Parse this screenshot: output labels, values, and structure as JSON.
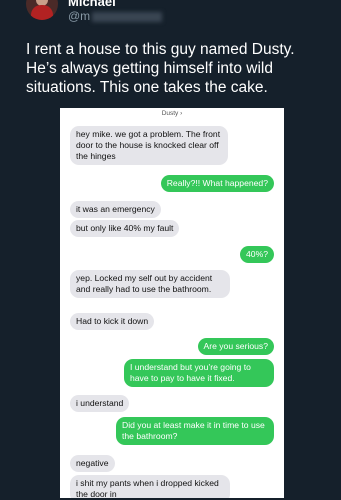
{
  "tweet": {
    "author_name": "Michael",
    "handle_prefix": "@m",
    "text": "I rent a house to this guy named Dusty. He’s always getting himself into wild situations. This one takes the cake."
  },
  "conversation": {
    "contact_name": "Dusty",
    "messages": [
      {
        "dir": "in",
        "text": "hey mike.  we got a problem. The front door to the house is knocked clear off the hinges"
      },
      {
        "dir": "out",
        "text": "Really?!! What happened?"
      },
      {
        "dir": "in",
        "text": "it was an emergency"
      },
      {
        "dir": "in",
        "text": "but only like 40% my fault"
      },
      {
        "dir": "out",
        "text": "40%?"
      },
      {
        "dir": "in",
        "text": "yep. Locked my self out by accident and really had to use the bathroom."
      },
      {
        "dir": "in",
        "text": "Had to kick it down"
      },
      {
        "dir": "out",
        "text": "Are you serious?"
      },
      {
        "dir": "out",
        "text": "I understand but you’re going to have to pay to have it fixed."
      },
      {
        "dir": "in",
        "text": "i understand"
      },
      {
        "dir": "out",
        "text": "Did you at least make it in time to use the bathroom?"
      },
      {
        "dir": "in",
        "text": "negative"
      },
      {
        "dir": "in",
        "text": "i shit my pants when i dropped kicked the door in"
      }
    ]
  },
  "colors": {
    "background": "#15202b",
    "incoming_bubble": "#e5e5ea",
    "outgoing_bubble": "#34c759"
  }
}
